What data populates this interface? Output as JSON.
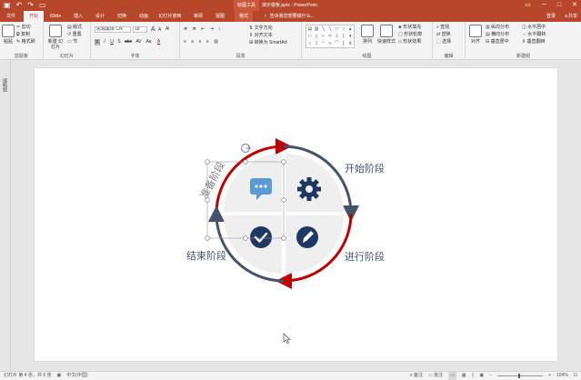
{
  "titlebar": {
    "save_icon": "save-icon",
    "undo": "↶",
    "redo": "↷",
    "context_tab": "绘图工具",
    "document_title": "演示模板.pptx - PowerPoint"
  },
  "tabs": [
    {
      "label": "文件"
    },
    {
      "label": "开始"
    },
    {
      "label": "iSlide"
    },
    {
      "label": "插入"
    },
    {
      "label": "设计"
    },
    {
      "label": "切换"
    },
    {
      "label": "动画"
    },
    {
      "label": "幻灯片放映"
    },
    {
      "label": "审阅"
    },
    {
      "label": "视图"
    },
    {
      "label": "格式"
    }
  ],
  "tell_me": "告诉我您想要做什么...",
  "user": "登录",
  "share": "共享",
  "ribbon": {
    "clipboard": {
      "label": "剪贴板",
      "paste": "粘贴",
      "cut": "剪切",
      "copy": "复制",
      "format_painter": "格式刷"
    },
    "slides": {
      "label": "幻灯片",
      "new_slide": "新建\n幻灯片",
      "layout": "版式",
      "reset": "重置",
      "section": "节"
    },
    "font": {
      "label": "字体",
      "font_name": "思源黑体 CN",
      "font_size": "18",
      "grow": "A",
      "shrink": "A",
      "bold": "B",
      "italic": "I",
      "underline": "U",
      "shadow": "S",
      "strike": "abc",
      "spacing": "AV",
      "case": "Aa",
      "color": "A"
    },
    "paragraph": {
      "label": "段落",
      "text_direction": "文字方向",
      "align_text": "对齐文本",
      "smartart": "转换为 SmartArt"
    },
    "drawing": {
      "label": "绘图",
      "arrange": "排列",
      "quick_styles": "快速样式",
      "fill": "形状填充",
      "outline": "形状轮廓",
      "effects": "形状效果"
    },
    "editing": {
      "label": "编辑",
      "find": "查找",
      "replace": "替换",
      "select": "选择"
    },
    "align_group": {
      "label": "新建组",
      "align": "对齐",
      "dist_h": "纵向分布",
      "dist_v": "横向分布",
      "center_v": "垂直居中",
      "center_h": "水平居中",
      "flip_h": "水平翻转",
      "flip_v": "垂直翻转"
    }
  },
  "rail_label": "缩略图",
  "diagram": {
    "stages": [
      {
        "label": "准备阶段",
        "icon": "chat-bubble-icon"
      },
      {
        "label": "开始阶段",
        "icon": "gear-icon"
      },
      {
        "label": "进行阶段",
        "icon": "pen-icon"
      },
      {
        "label": "结束阶段",
        "icon": "checkmark-icon"
      }
    ],
    "colors": {
      "accent_red": "#c00000",
      "accent_navy": "#44546a",
      "icon_blue": "#5b9bd5",
      "icon_navy": "#1f3864",
      "quadrant_fill": "#efefef"
    }
  },
  "status": {
    "slide_info": "幻灯片 第 4 张，共 6 张",
    "language": "中文(中国)",
    "notes": "备注",
    "comments": "批注",
    "zoom": "104%"
  }
}
